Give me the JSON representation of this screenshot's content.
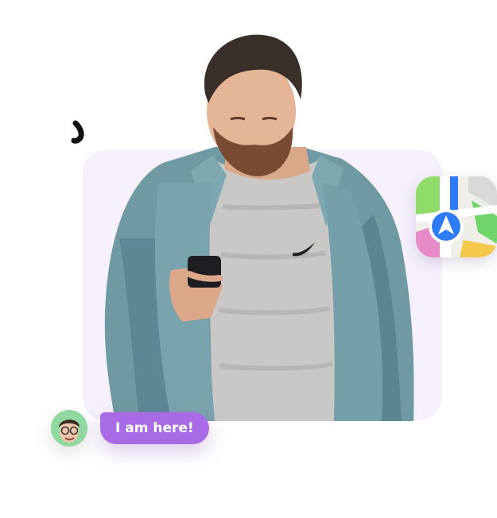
{
  "chat": {
    "message": "I am here!"
  },
  "icons": {
    "app_icon": "maps-navigation-icon",
    "avatar": "memoji-avatar-icon",
    "decoration": "squiggle-icon"
  },
  "colors": {
    "card_background": "#f6f1fd",
    "bubble_background": "#a96ae6",
    "avatar_background": "#8fd8a0",
    "maps_arrow": "#2e7bf6"
  }
}
